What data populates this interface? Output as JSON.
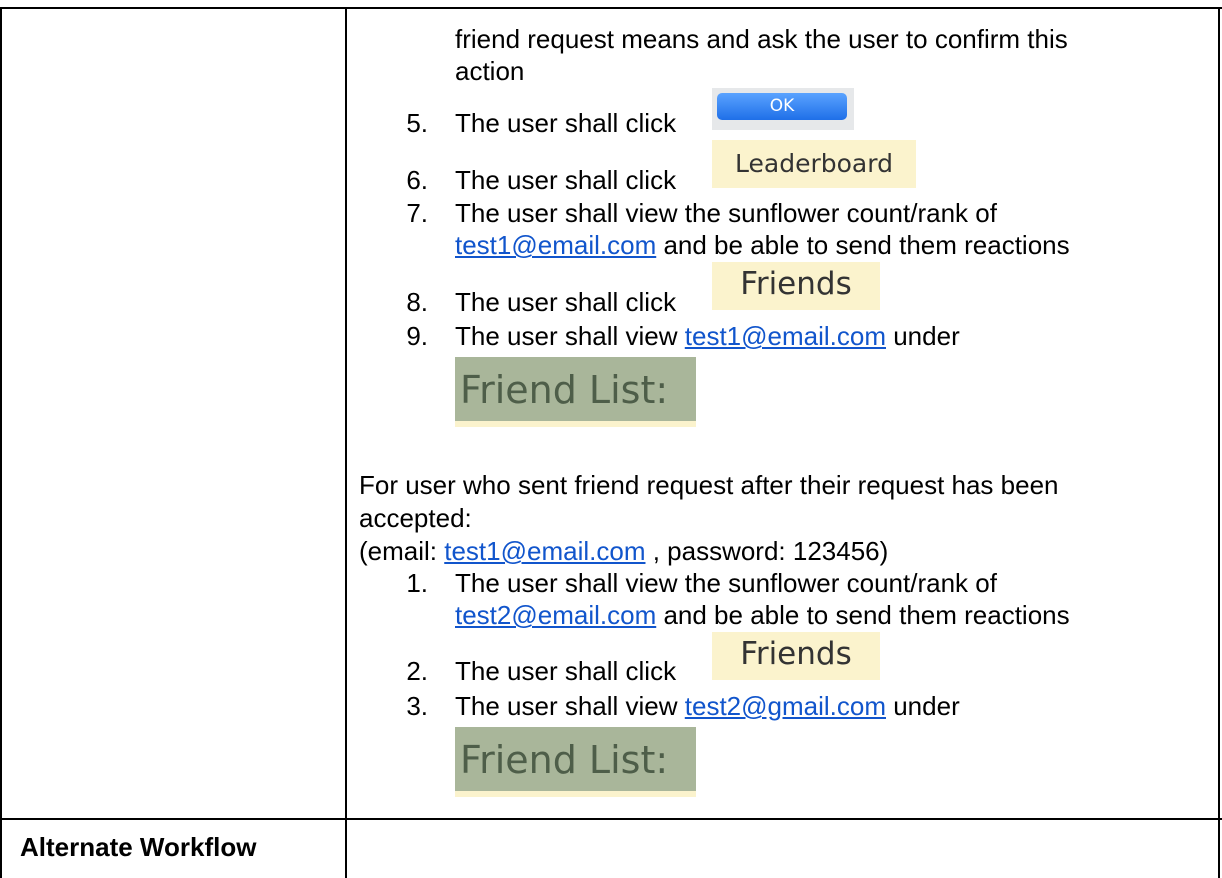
{
  "continuation": {
    "line1": "friend request means and ask the user to confirm this",
    "line2": "action"
  },
  "steps_a": [
    {
      "num": "5.",
      "text": "The user shall click",
      "button": "OK"
    },
    {
      "num": "6.",
      "text": "The user shall click",
      "button": "Leaderboard"
    },
    {
      "num": "7.",
      "text": "The user shall view the sunflower count/rank of",
      "link": "test1@email.com",
      "after": " and be able to send them reactions"
    },
    {
      "num": "8.",
      "text": "The user shall click",
      "button": "Friends"
    },
    {
      "num": "9.",
      "text": "The user shall view ",
      "link": "test1@email.com",
      "after": " under",
      "image_label": "Friend List:"
    }
  ],
  "section_b": {
    "heading_line1": "For user who sent friend request after their request has been",
    "heading_line2": "accepted:",
    "cred_prefix": "(email: ",
    "cred_email": "test1@email.com",
    "cred_suffix": " , password: 123456)"
  },
  "steps_b": [
    {
      "num": "1.",
      "text": "The user shall view the sunflower count/rank of",
      "link": "test2@email.com",
      "after": " and be able to send them reactions"
    },
    {
      "num": "2.",
      "text": "The user shall click",
      "button": "Friends"
    },
    {
      "num": "3.",
      "text": "The user shall view ",
      "link": "test2@gmail.com",
      "after": " under",
      "image_label": "Friend List:"
    }
  ],
  "footer_row": {
    "label": "Alternate Workflow"
  },
  "colors": {
    "link": "#1155cc",
    "chip_bg": "#fbf3cd",
    "friend_list_bg": "#a9b69a",
    "ok_button": "#2f7df0"
  }
}
